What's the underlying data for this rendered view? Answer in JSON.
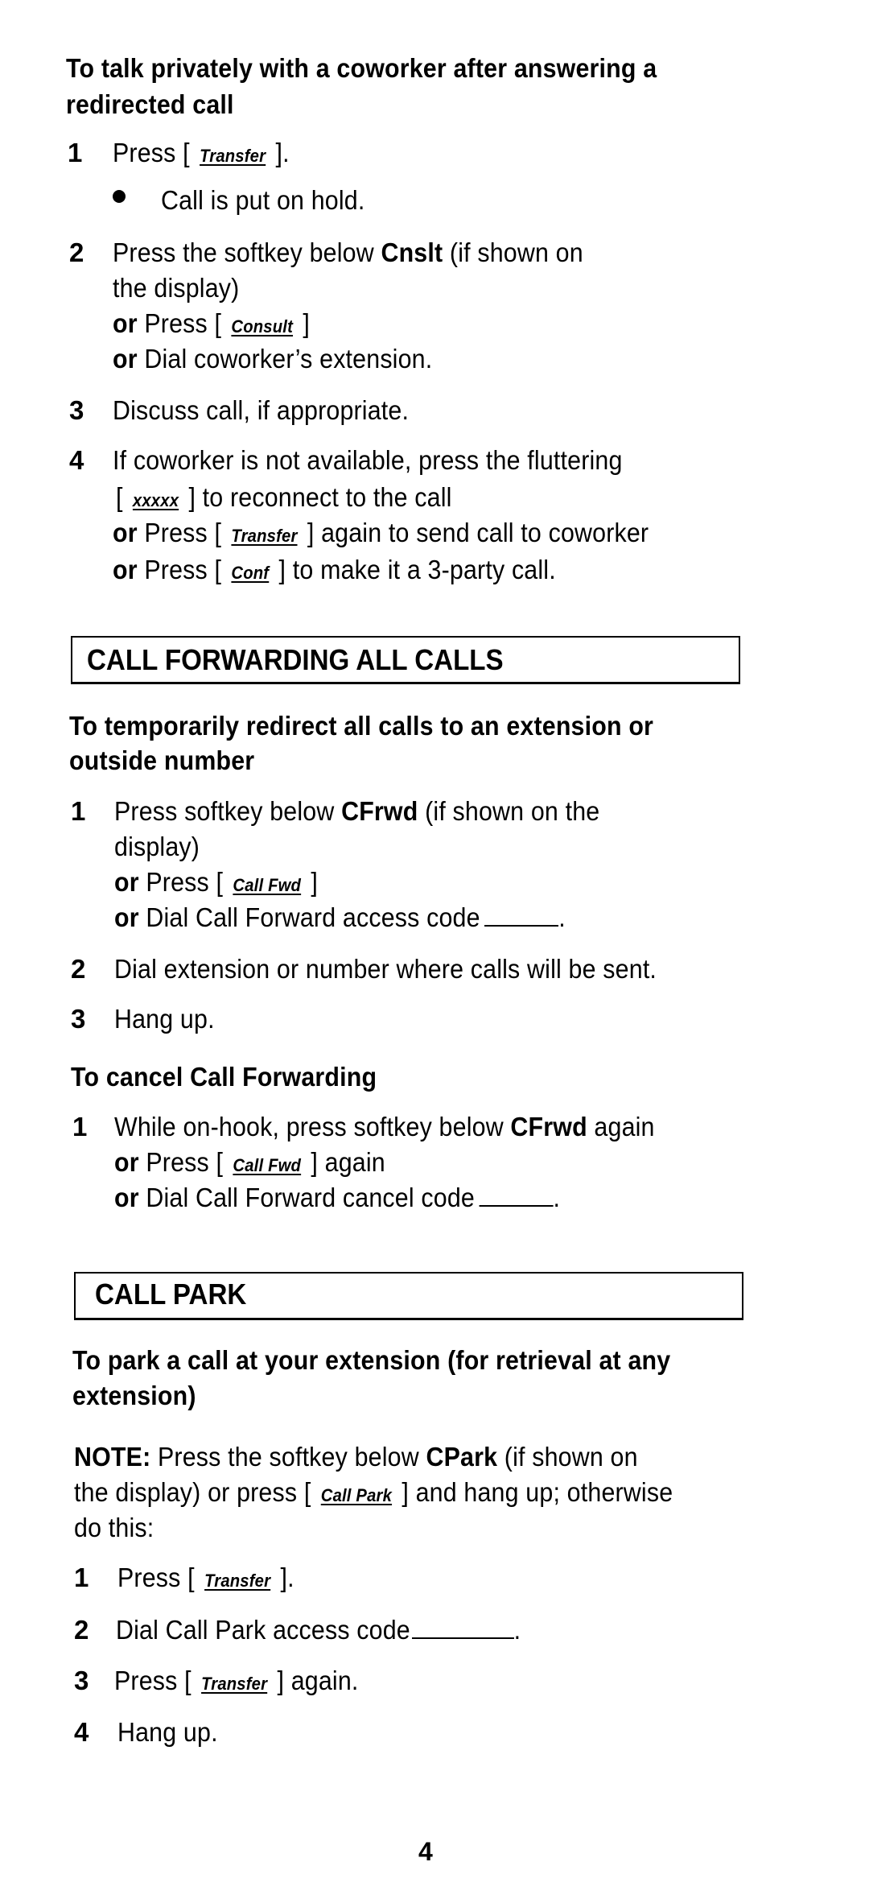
{
  "section_transfer": {
    "heading_line1": "To talk privately with a coworker after answering a",
    "heading_line2": "redirected  call",
    "steps": [
      {
        "num": "1",
        "pre": "Press [ ",
        "key": "Transfer",
        "post": " ]."
      },
      {
        "bullet": "Call is put on hold."
      },
      {
        "num": "2",
        "line1_pre": "Press the softkey below ",
        "line1_bold": "Cnslt",
        "line1_post": " (if shown on",
        "line2": "the display)",
        "or1_or": "or",
        "or1_pre": " Press [ ",
        "or1_key": "Consult",
        "or1_post": " ]",
        "or2_or": "or",
        "or2_text": " Dial  coworker’s  extension."
      },
      {
        "num": "3",
        "text": "Discuss  call,  if  appropriate."
      },
      {
        "num": "4",
        "line1": "If coworker is not available, press the fluttering",
        "line2_pre": "[ ",
        "line2_key": "xxxxx",
        "line2_post": "  ] to reconnect to the call",
        "or1_or": "or",
        "or1_pre": " Press [ ",
        "or1_key": "Transfer",
        "or1_post": " ] again to send call to coworker",
        "or2_or": "or",
        "or2_pre": " Press [ ",
        "or2_key": "Conf",
        "or2_post": " ] to make it a 3-party call."
      }
    ]
  },
  "section_call_forwarding": {
    "title": "CALL  FORWARDING  ALL  CALLS",
    "heading_line1": "To temporarily redirect all calls to an extension or",
    "heading_line2": "outside  number",
    "steps": [
      {
        "num": "1",
        "line1_pre": "Press softkey below ",
        "line1_bold": "CFrwd",
        "line1_post": " (if shown on the",
        "line2": "display)",
        "or1_or": "or",
        "or1_pre": " Press [ ",
        "or1_key": "Call  Fwd",
        "or1_post": " ]",
        "or2_or": "or",
        "or2_text": " Dial Call Forward access code",
        "or2_end": "."
      },
      {
        "num": "2",
        "text": "Dial extension or number where calls will be sent."
      },
      {
        "num": "3",
        "text": "Hang  up."
      }
    ],
    "cancel_heading": "To cancel Call Forwarding",
    "cancel_steps": [
      {
        "num": "1",
        "line1_pre": "While on-hook, press softkey below ",
        "line1_bold": "CFrwd",
        "line1_post": " again",
        "or1_or": "or",
        "or1_pre": " Press [ ",
        "or1_key": "Call  Fwd",
        "or1_post": " ] again",
        "or2_or": "or",
        "or2_text": " Dial Call Forward cancel code",
        "or2_end": "."
      }
    ]
  },
  "section_call_park": {
    "title": "CALL  PARK",
    "heading_line1": "To park a call at your extension (for retrieval at any",
    "heading_line2": "extension)",
    "note_label": "NOTE:",
    "note_line1_pre": " Press the softkey below ",
    "note_line1_bold": "CPark",
    "note_line1_post": " (if shown on",
    "note_line2_pre": "the display) or press [ ",
    "note_line2_key": "Call Park",
    "note_line2_post": " ] and hang up; otherwise",
    "note_line3": "do this:",
    "steps": [
      {
        "num": "1",
        "pre": "Press [ ",
        "key": "Transfer",
        "post": " ]."
      },
      {
        "num": "2",
        "text": "Dial Call Park access code",
        "end": "."
      },
      {
        "num": "3",
        "pre": "Press [ ",
        "key": "Transfer",
        "post": "  ] again."
      },
      {
        "num": "4",
        "text": "Hang up."
      }
    ]
  },
  "page_number": "4"
}
